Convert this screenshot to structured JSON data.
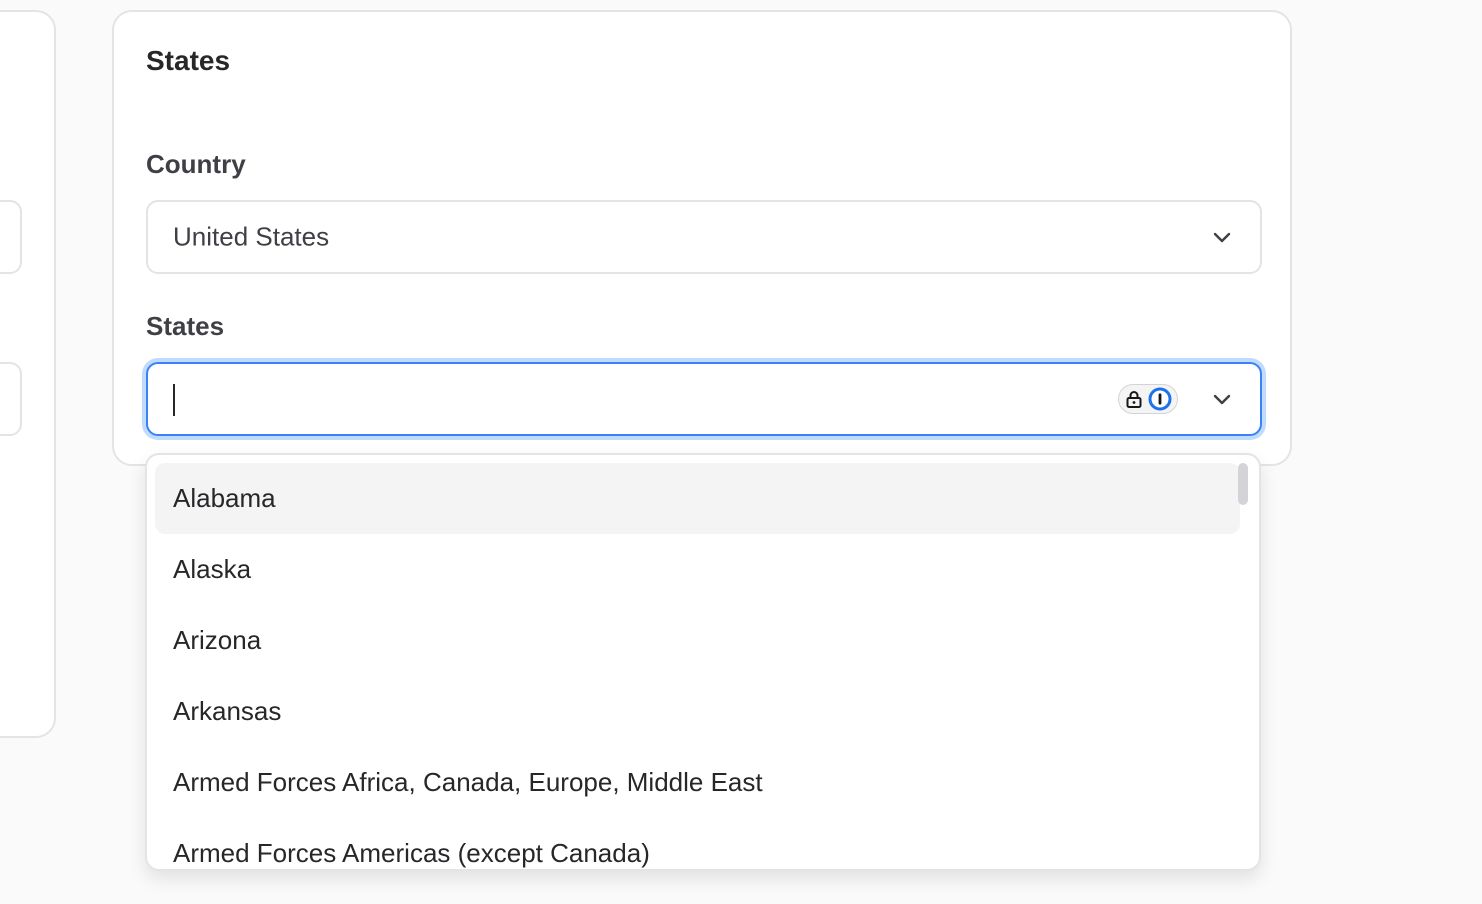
{
  "card": {
    "title": "States"
  },
  "country_field": {
    "label": "Country",
    "value": "United States"
  },
  "states_field": {
    "label": "States",
    "value": ""
  },
  "dropdown": {
    "options": [
      "Alabama",
      "Alaska",
      "Arizona",
      "Arkansas",
      "Armed Forces Africa, Canada, Europe, Middle East",
      "Armed Forces Americas (except Canada)"
    ],
    "highlighted_index": 0
  },
  "colors": {
    "focus_border": "#3b82f6",
    "focus_ring": "#bfdbfe",
    "highlight_bg": "#f4f4f5",
    "password_manager_blue": "#1a73e8"
  },
  "icons": {
    "select_chevron": "chevron-down-icon",
    "password_manager": "password-manager-icon",
    "lock": "lock-icon"
  }
}
